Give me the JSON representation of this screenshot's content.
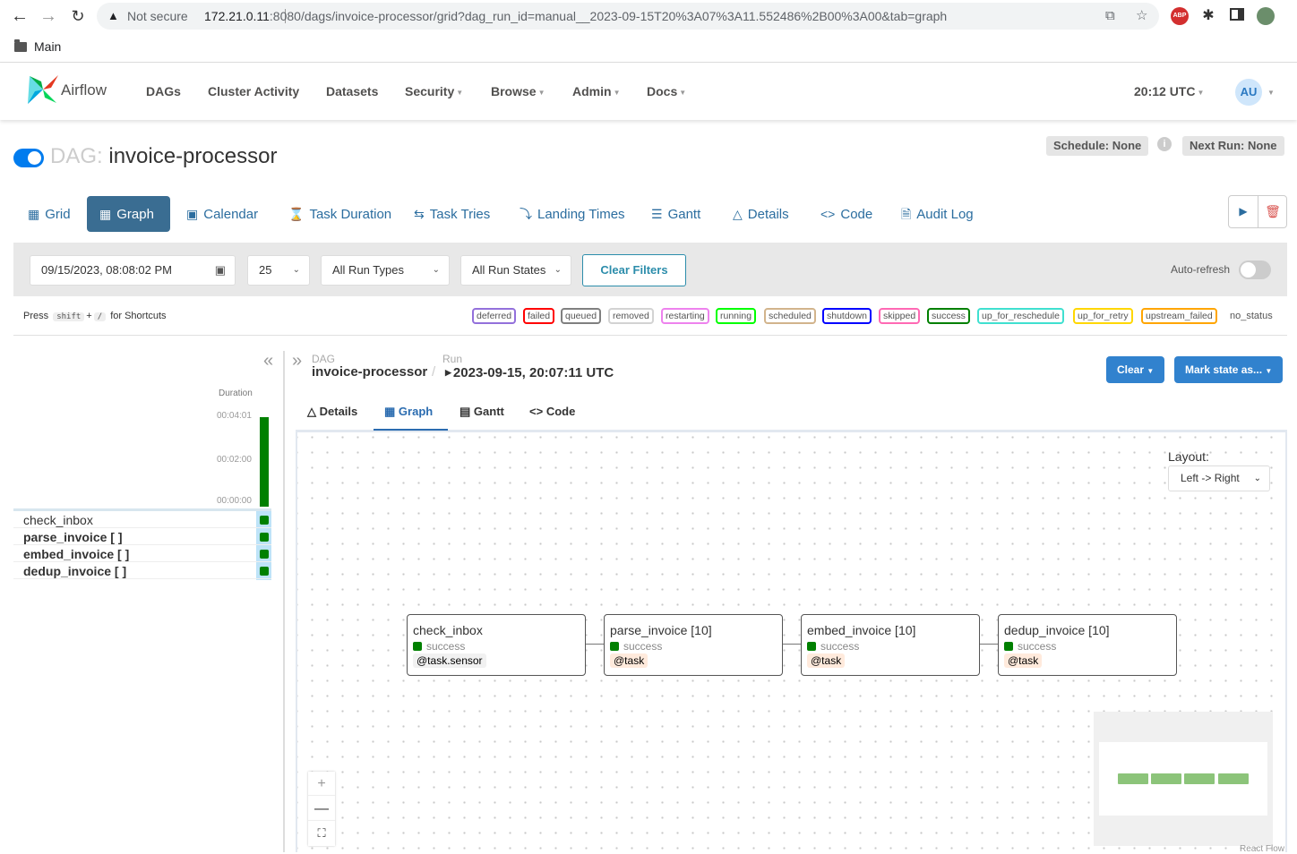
{
  "browser": {
    "not_secure": "Not secure",
    "url_host": "172.21.0.11",
    "url_path": ":8080/dags/invoice-processor/grid?dag_run_id=manual__2023-09-15T20%3A07%3A11.552486%2B00%3A00&tab=graph",
    "bookmark_folder": "Main",
    "ext_abp": "ABP"
  },
  "nav": {
    "logo_text": "Airflow",
    "items": [
      "DAGs",
      "Cluster Activity",
      "Datasets",
      "Security",
      "Browse",
      "Admin",
      "Docs"
    ],
    "time": "20:12 UTC",
    "avatar": "AU"
  },
  "dag": {
    "prefix": "DAG:",
    "name": "invoice-processor",
    "schedule": "Schedule: None",
    "next_run": "Next Run: None",
    "info": "i"
  },
  "tabs": [
    "Grid",
    "Graph",
    "Calendar",
    "Task Duration",
    "Task Tries",
    "Landing Times",
    "Gantt",
    "Details",
    "Code",
    "Audit Log"
  ],
  "filters": {
    "date": "09/15/2023, 08:08:02 PM",
    "count": "25",
    "run_types": "All Run Types",
    "run_states": "All Run States",
    "clear": "Clear Filters",
    "auto_refresh": "Auto-refresh",
    "auto_refresh_on": false
  },
  "shortcuts": {
    "press": "Press",
    "key1": "shift",
    "plus": "+",
    "key2": "/",
    "suffix": "for Shortcuts"
  },
  "legend": [
    {
      "label": "deferred",
      "color": "#9370db"
    },
    {
      "label": "failed",
      "color": "#ff0000"
    },
    {
      "label": "queued",
      "color": "#808080"
    },
    {
      "label": "removed",
      "color": "#d3d3d3"
    },
    {
      "label": "restarting",
      "color": "#ee82ee"
    },
    {
      "label": "running",
      "color": "#00ff00"
    },
    {
      "label": "scheduled",
      "color": "#d2b48c"
    },
    {
      "label": "shutdown",
      "color": "#0000ff"
    },
    {
      "label": "skipped",
      "color": "#ff69b4"
    },
    {
      "label": "success",
      "color": "#008000"
    },
    {
      "label": "up_for_reschedule",
      "color": "#40e0d0"
    },
    {
      "label": "up_for_retry",
      "color": "#ffd700"
    },
    {
      "label": "upstream_failed",
      "color": "#ffa500"
    },
    {
      "label": "no_status",
      "color": null
    }
  ],
  "grid": {
    "duration_label": "Duration",
    "ticks": [
      "00:04:01",
      "00:02:00",
      "00:00:00"
    ],
    "tasks": [
      {
        "name": "check_inbox",
        "bold": false
      },
      {
        "name": "parse_invoice [ ]",
        "bold": true
      },
      {
        "name": "embed_invoice [ ]",
        "bold": true
      },
      {
        "name": "dedup_invoice [ ]",
        "bold": true
      }
    ]
  },
  "breadcrumb": {
    "dag_label": "DAG",
    "dag_value": "invoice-processor",
    "run_label": "Run",
    "run_value": "2023-09-15, 20:07:11 UTC"
  },
  "actions": {
    "clear": "Clear",
    "mark_state": "Mark state as..."
  },
  "subtabs": [
    "Details",
    "Graph",
    "Gantt",
    "Code"
  ],
  "graph": {
    "layout_label": "Layout:",
    "layout_value": "Left -> Right",
    "attribution": "React Flow",
    "nodes": [
      {
        "title": "check_inbox",
        "status": "success",
        "operator": "@task.sensor"
      },
      {
        "title": "parse_invoice [10]",
        "status": "success",
        "operator": "@task"
      },
      {
        "title": "embed_invoice [10]",
        "status": "success",
        "operator": "@task"
      },
      {
        "title": "dedup_invoice [10]",
        "status": "success",
        "operator": "@task"
      }
    ]
  }
}
